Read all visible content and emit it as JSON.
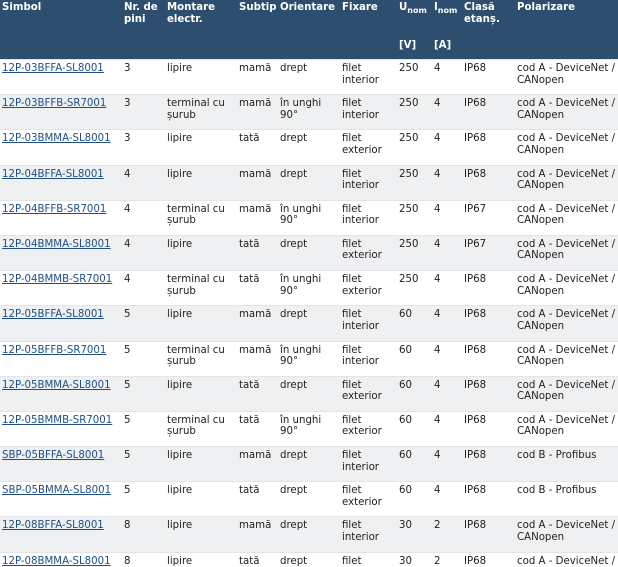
{
  "headers": {
    "simbol": "Simbol",
    "nr_pini": "Nr. de pini",
    "montare": "Montare electr.",
    "subtip": "Subtip",
    "orientare": "Orientare",
    "fixare": "Fixare",
    "unom_main": "U",
    "unom_sub": "nom",
    "unom_unit": "[V]",
    "inom_main": "I",
    "inom_sub": "nom",
    "inom_unit": "[A]",
    "clasa": "Clasă etanș.",
    "polarizare": "Polarizare"
  },
  "rows": [
    {
      "simbol": "12P-03BFFA-SL8001",
      "pini": "3",
      "montare": "lipire",
      "subtip": "mamă",
      "orientare": "drept",
      "fixare": "filet interior",
      "u": "250",
      "i": "4",
      "clasa": "IP68",
      "polarizare": "cod A - DeviceNet / CANopen"
    },
    {
      "simbol": "12P-03BFFB-SR7001",
      "pini": "3",
      "montare": "terminal cu șurub",
      "subtip": "mamă",
      "orientare": "în unghi 90°",
      "fixare": "filet interior",
      "u": "250",
      "i": "4",
      "clasa": "IP68",
      "polarizare": "cod A - DeviceNet / CANopen"
    },
    {
      "simbol": "12P-03BMMA-SL8001",
      "pini": "3",
      "montare": "lipire",
      "subtip": "tată",
      "orientare": "drept",
      "fixare": "filet exterior",
      "u": "250",
      "i": "4",
      "clasa": "IP68",
      "polarizare": "cod A - DeviceNet / CANopen"
    },
    {
      "simbol": "12P-04BFFA-SL8001",
      "pini": "4",
      "montare": "lipire",
      "subtip": "mamă",
      "orientare": "drept",
      "fixare": "filet interior",
      "u": "250",
      "i": "4",
      "clasa": "IP68",
      "polarizare": "cod A - DeviceNet / CANopen"
    },
    {
      "simbol": "12P-04BFFB-SR7001",
      "pini": "4",
      "montare": "terminal cu șurub",
      "subtip": "mamă",
      "orientare": "în unghi 90°",
      "fixare": "filet interior",
      "u": "250",
      "i": "4",
      "clasa": "IP67",
      "polarizare": "cod A - DeviceNet / CANopen"
    },
    {
      "simbol": "12P-04BMMA-SL8001",
      "pini": "4",
      "montare": "lipire",
      "subtip": "tată",
      "orientare": "drept",
      "fixare": "filet exterior",
      "u": "250",
      "i": "4",
      "clasa": "IP67",
      "polarizare": "cod A - DeviceNet / CANopen"
    },
    {
      "simbol": "12P-04BMMB-SR7001",
      "pini": "4",
      "montare": "terminal cu șurub",
      "subtip": "tată",
      "orientare": "în unghi 90°",
      "fixare": "filet exterior",
      "u": "250",
      "i": "4",
      "clasa": "IP68",
      "polarizare": "cod A - DeviceNet / CANopen"
    },
    {
      "simbol": "12P-05BFFA-SL8001",
      "pini": "5",
      "montare": "lipire",
      "subtip": "mamă",
      "orientare": "drept",
      "fixare": "filet interior",
      "u": "60",
      "i": "4",
      "clasa": "IP68",
      "polarizare": "cod A - DeviceNet / CANopen"
    },
    {
      "simbol": "12P-05BFFB-SR7001",
      "pini": "5",
      "montare": "terminal cu șurub",
      "subtip": "mamă",
      "orientare": "în unghi 90°",
      "fixare": "filet interior",
      "u": "60",
      "i": "4",
      "clasa": "IP68",
      "polarizare": "cod A - DeviceNet / CANopen"
    },
    {
      "simbol": "12P-05BMMA-SL8001",
      "pini": "5",
      "montare": "lipire",
      "subtip": "tată",
      "orientare": "drept",
      "fixare": "filet exterior",
      "u": "60",
      "i": "4",
      "clasa": "IP68",
      "polarizare": "cod A - DeviceNet / CANopen"
    },
    {
      "simbol": "12P-05BMMB-SR7001",
      "pini": "5",
      "montare": "terminal cu șurub",
      "subtip": "tată",
      "orientare": "în unghi 90°",
      "fixare": "filet exterior",
      "u": "60",
      "i": "4",
      "clasa": "IP68",
      "polarizare": "cod A - DeviceNet / CANopen"
    },
    {
      "simbol": "SBP-05BFFA-SL8001",
      "pini": "5",
      "montare": "lipire",
      "subtip": "mamă",
      "orientare": "drept",
      "fixare": "filet interior",
      "u": "60",
      "i": "4",
      "clasa": "IP68",
      "polarizare": "cod B - Profibus"
    },
    {
      "simbol": "SBP-05BMMA-SL8001",
      "pini": "5",
      "montare": "lipire",
      "subtip": "tată",
      "orientare": "drept",
      "fixare": "filet exterior",
      "u": "60",
      "i": "4",
      "clasa": "IP68",
      "polarizare": "cod B - Profibus"
    },
    {
      "simbol": "12P-08BFFA-SL8001",
      "pini": "8",
      "montare": "lipire",
      "subtip": "mamă",
      "orientare": "drept",
      "fixare": "filet interior",
      "u": "30",
      "i": "2",
      "clasa": "IP68",
      "polarizare": "cod A - DeviceNet / CANopen"
    },
    {
      "simbol": "12P-08BMMA-SL8001",
      "pini": "8",
      "montare": "lipire",
      "subtip": "tată",
      "orientare": "drept",
      "fixare": "filet exterior",
      "u": "30",
      "i": "2",
      "clasa": "IP68",
      "polarizare": "cod A - DeviceNet / CANopen"
    }
  ],
  "colors": {
    "header_bg": "#2d4e6e",
    "link": "#1f4f86",
    "row_alt": "#eef0f2"
  }
}
